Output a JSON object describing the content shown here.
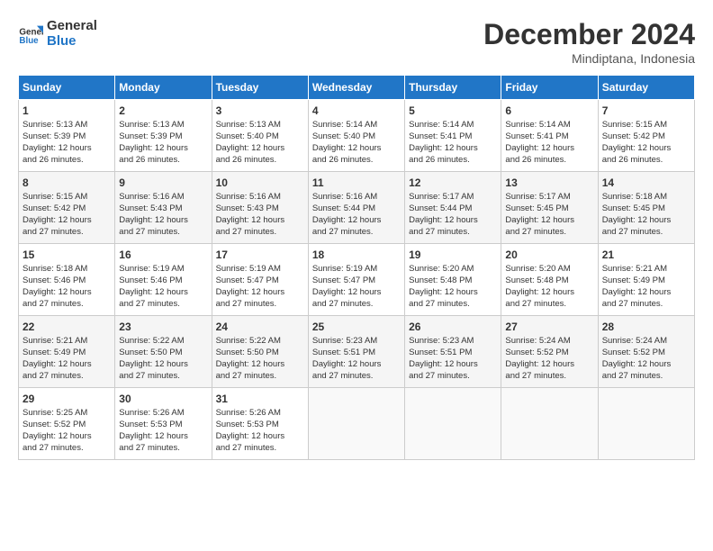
{
  "header": {
    "logo_line1": "General",
    "logo_line2": "Blue",
    "month": "December 2024",
    "location": "Mindiptana, Indonesia"
  },
  "weekdays": [
    "Sunday",
    "Monday",
    "Tuesday",
    "Wednesday",
    "Thursday",
    "Friday",
    "Saturday"
  ],
  "weeks": [
    [
      {
        "day": "1",
        "info": "Sunrise: 5:13 AM\nSunset: 5:39 PM\nDaylight: 12 hours\nand 26 minutes."
      },
      {
        "day": "2",
        "info": "Sunrise: 5:13 AM\nSunset: 5:39 PM\nDaylight: 12 hours\nand 26 minutes."
      },
      {
        "day": "3",
        "info": "Sunrise: 5:13 AM\nSunset: 5:40 PM\nDaylight: 12 hours\nand 26 minutes."
      },
      {
        "day": "4",
        "info": "Sunrise: 5:14 AM\nSunset: 5:40 PM\nDaylight: 12 hours\nand 26 minutes."
      },
      {
        "day": "5",
        "info": "Sunrise: 5:14 AM\nSunset: 5:41 PM\nDaylight: 12 hours\nand 26 minutes."
      },
      {
        "day": "6",
        "info": "Sunrise: 5:14 AM\nSunset: 5:41 PM\nDaylight: 12 hours\nand 26 minutes."
      },
      {
        "day": "7",
        "info": "Sunrise: 5:15 AM\nSunset: 5:42 PM\nDaylight: 12 hours\nand 26 minutes."
      }
    ],
    [
      {
        "day": "8",
        "info": "Sunrise: 5:15 AM\nSunset: 5:42 PM\nDaylight: 12 hours\nand 27 minutes."
      },
      {
        "day": "9",
        "info": "Sunrise: 5:16 AM\nSunset: 5:43 PM\nDaylight: 12 hours\nand 27 minutes."
      },
      {
        "day": "10",
        "info": "Sunrise: 5:16 AM\nSunset: 5:43 PM\nDaylight: 12 hours\nand 27 minutes."
      },
      {
        "day": "11",
        "info": "Sunrise: 5:16 AM\nSunset: 5:44 PM\nDaylight: 12 hours\nand 27 minutes."
      },
      {
        "day": "12",
        "info": "Sunrise: 5:17 AM\nSunset: 5:44 PM\nDaylight: 12 hours\nand 27 minutes."
      },
      {
        "day": "13",
        "info": "Sunrise: 5:17 AM\nSunset: 5:45 PM\nDaylight: 12 hours\nand 27 minutes."
      },
      {
        "day": "14",
        "info": "Sunrise: 5:18 AM\nSunset: 5:45 PM\nDaylight: 12 hours\nand 27 minutes."
      }
    ],
    [
      {
        "day": "15",
        "info": "Sunrise: 5:18 AM\nSunset: 5:46 PM\nDaylight: 12 hours\nand 27 minutes."
      },
      {
        "day": "16",
        "info": "Sunrise: 5:19 AM\nSunset: 5:46 PM\nDaylight: 12 hours\nand 27 minutes."
      },
      {
        "day": "17",
        "info": "Sunrise: 5:19 AM\nSunset: 5:47 PM\nDaylight: 12 hours\nand 27 minutes."
      },
      {
        "day": "18",
        "info": "Sunrise: 5:19 AM\nSunset: 5:47 PM\nDaylight: 12 hours\nand 27 minutes."
      },
      {
        "day": "19",
        "info": "Sunrise: 5:20 AM\nSunset: 5:48 PM\nDaylight: 12 hours\nand 27 minutes."
      },
      {
        "day": "20",
        "info": "Sunrise: 5:20 AM\nSunset: 5:48 PM\nDaylight: 12 hours\nand 27 minutes."
      },
      {
        "day": "21",
        "info": "Sunrise: 5:21 AM\nSunset: 5:49 PM\nDaylight: 12 hours\nand 27 minutes."
      }
    ],
    [
      {
        "day": "22",
        "info": "Sunrise: 5:21 AM\nSunset: 5:49 PM\nDaylight: 12 hours\nand 27 minutes."
      },
      {
        "day": "23",
        "info": "Sunrise: 5:22 AM\nSunset: 5:50 PM\nDaylight: 12 hours\nand 27 minutes."
      },
      {
        "day": "24",
        "info": "Sunrise: 5:22 AM\nSunset: 5:50 PM\nDaylight: 12 hours\nand 27 minutes."
      },
      {
        "day": "25",
        "info": "Sunrise: 5:23 AM\nSunset: 5:51 PM\nDaylight: 12 hours\nand 27 minutes."
      },
      {
        "day": "26",
        "info": "Sunrise: 5:23 AM\nSunset: 5:51 PM\nDaylight: 12 hours\nand 27 minutes."
      },
      {
        "day": "27",
        "info": "Sunrise: 5:24 AM\nSunset: 5:52 PM\nDaylight: 12 hours\nand 27 minutes."
      },
      {
        "day": "28",
        "info": "Sunrise: 5:24 AM\nSunset: 5:52 PM\nDaylight: 12 hours\nand 27 minutes."
      }
    ],
    [
      {
        "day": "29",
        "info": "Sunrise: 5:25 AM\nSunset: 5:52 PM\nDaylight: 12 hours\nand 27 minutes."
      },
      {
        "day": "30",
        "info": "Sunrise: 5:26 AM\nSunset: 5:53 PM\nDaylight: 12 hours\nand 27 minutes."
      },
      {
        "day": "31",
        "info": "Sunrise: 5:26 AM\nSunset: 5:53 PM\nDaylight: 12 hours\nand 27 minutes."
      },
      {
        "day": "",
        "info": ""
      },
      {
        "day": "",
        "info": ""
      },
      {
        "day": "",
        "info": ""
      },
      {
        "day": "",
        "info": ""
      }
    ]
  ]
}
